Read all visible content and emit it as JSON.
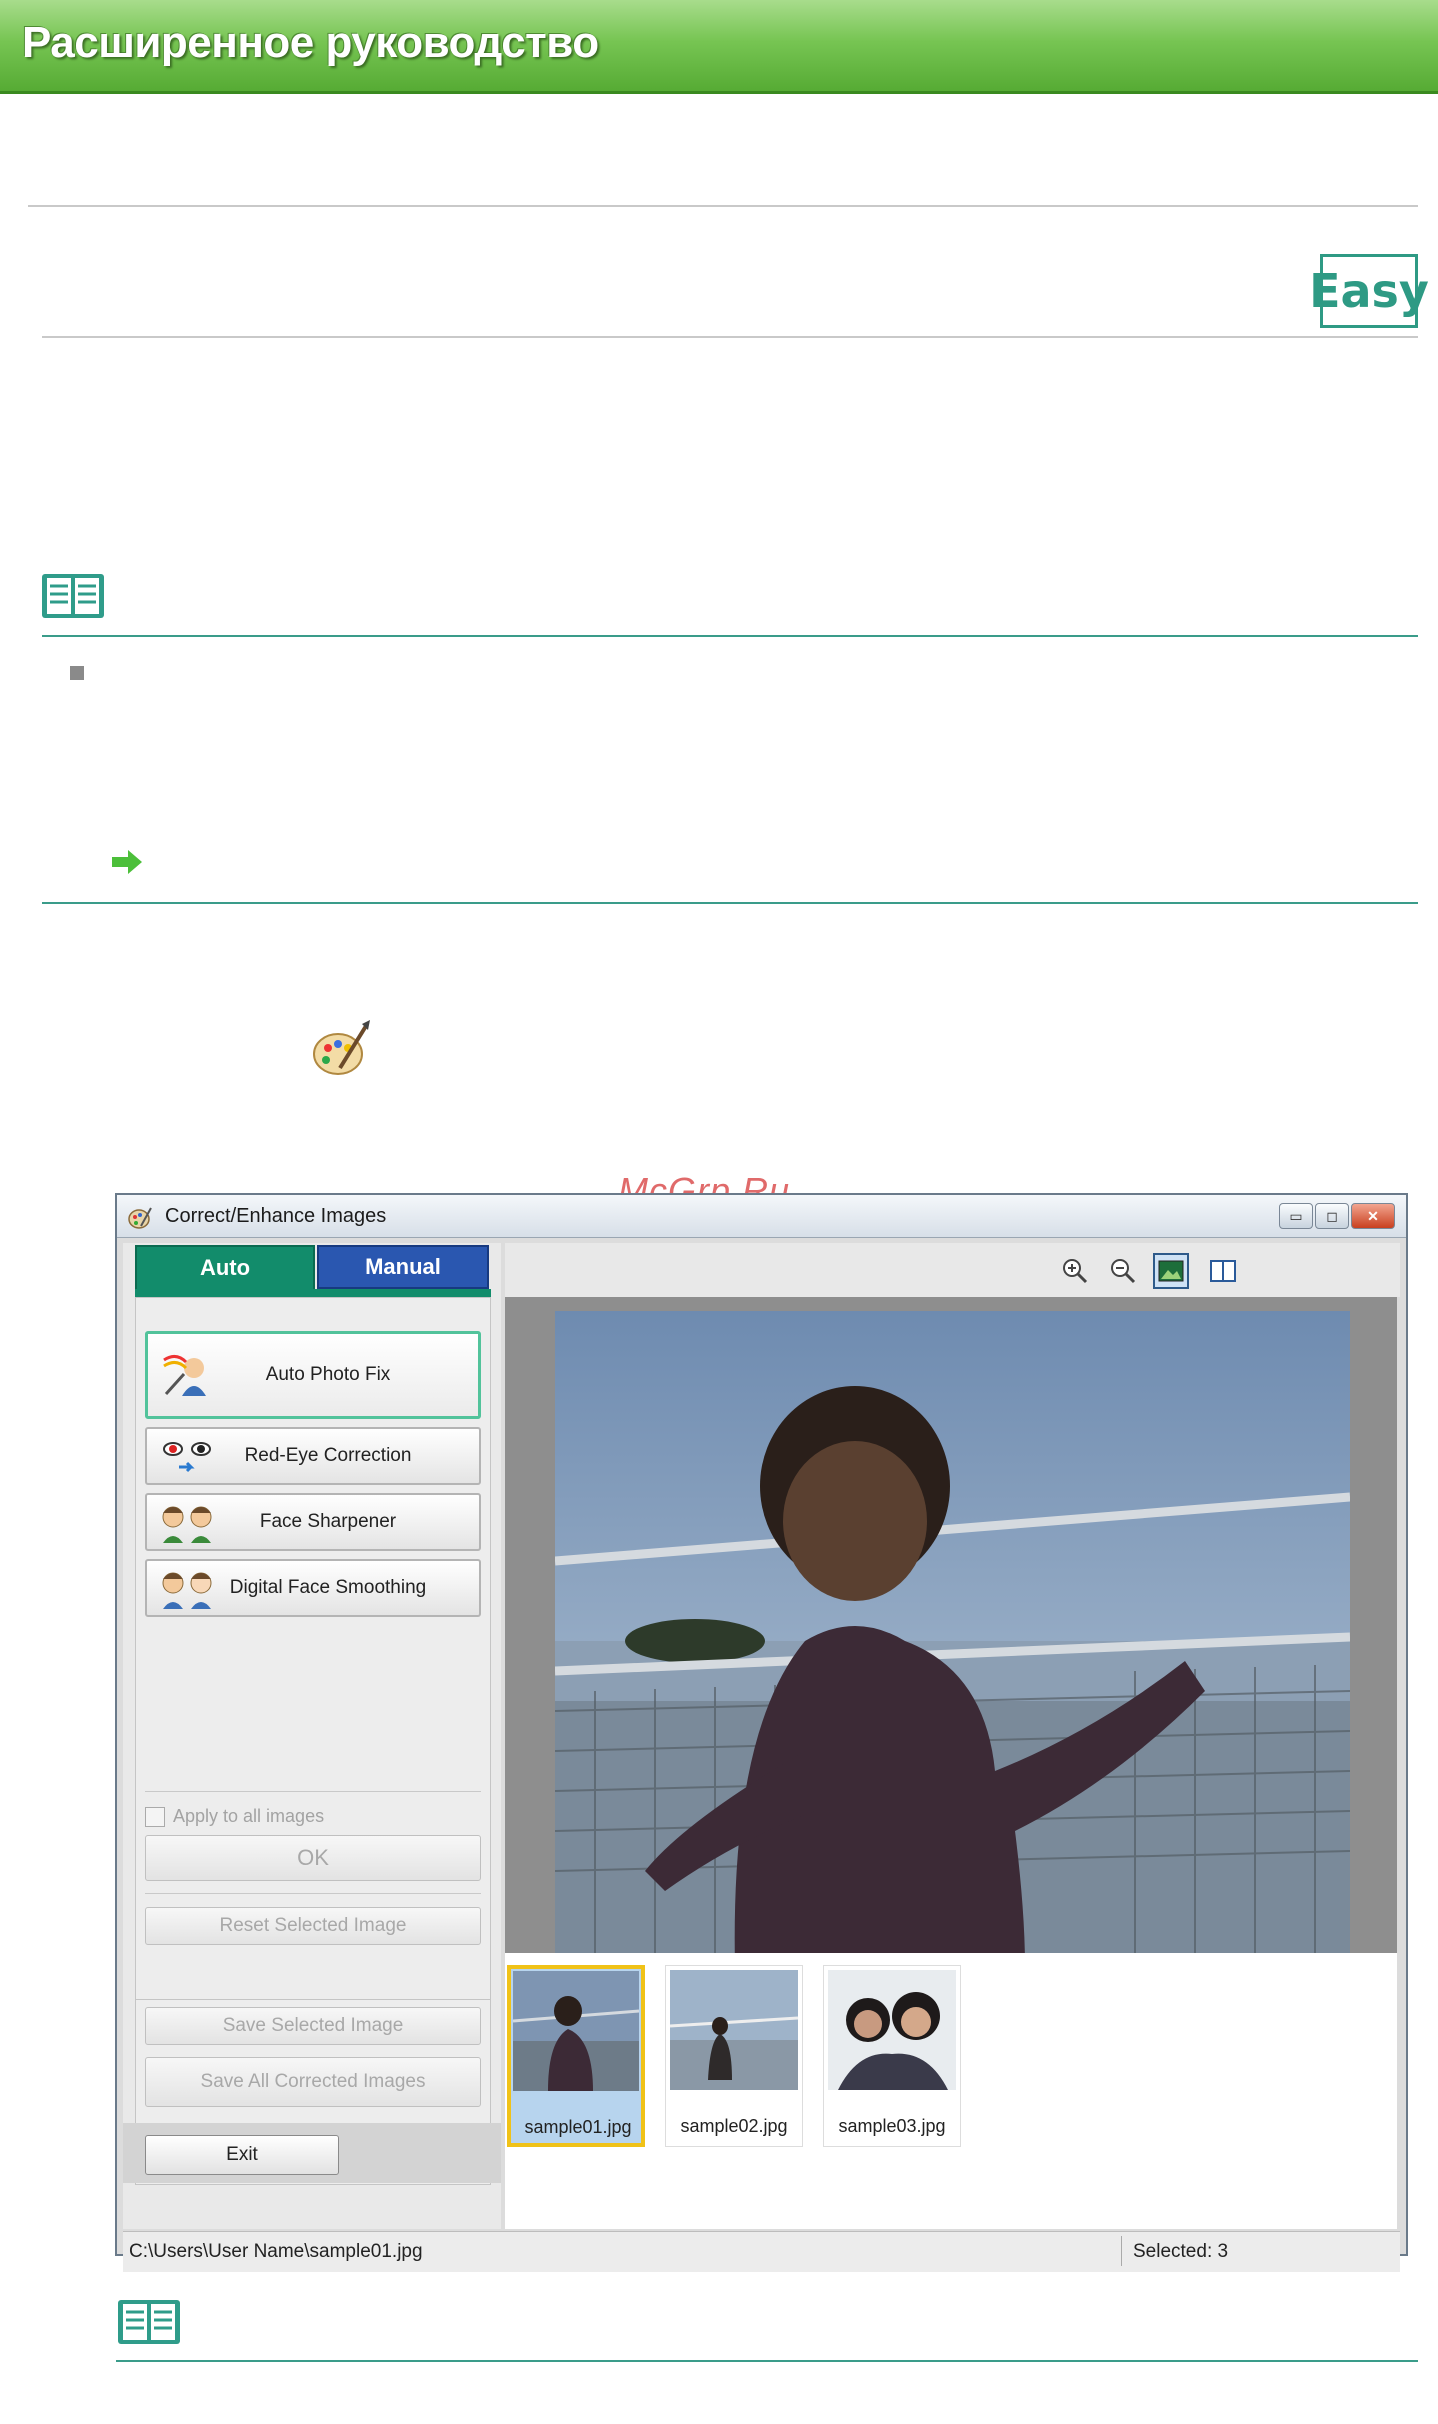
{
  "header": {
    "title": "Расширенное руководство"
  },
  "badge": {
    "label": "Easy"
  },
  "watermark": "McGrp.Ru",
  "window": {
    "title": "Correct/Enhance Images",
    "tabs": {
      "auto": "Auto",
      "manual": "Manual"
    },
    "buttons": {
      "auto_photo_fix": "Auto Photo Fix",
      "red_eye": "Red-Eye Correction",
      "face_sharpener": "Face Sharpener",
      "face_smoothing": "Digital Face Smoothing",
      "ok": "OK",
      "reset": "Reset Selected Image",
      "save_selected": "Save Selected Image",
      "save_all": "Save All Corrected Images",
      "exit": "Exit"
    },
    "apply_all": {
      "label": "Apply to all images",
      "checked": false
    },
    "thumbnails": [
      "sample01.jpg",
      "sample02.jpg",
      "sample03.jpg"
    ],
    "status": {
      "path": "C:\\Users\\User Name\\sample01.jpg",
      "selected": "Selected: 3"
    }
  }
}
